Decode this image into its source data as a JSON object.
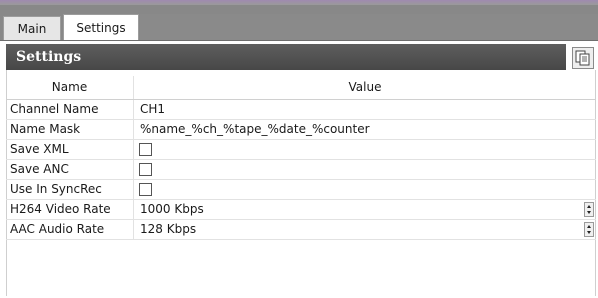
{
  "tabs": [
    {
      "label": "Main"
    },
    {
      "label": "Settings"
    }
  ],
  "panel": {
    "title": "Settings"
  },
  "grid": {
    "headers": {
      "name": "Name",
      "value": "Value"
    },
    "rows": [
      {
        "name": "Channel Name",
        "value": "CH1"
      },
      {
        "name": "Name Mask",
        "value": "%name_%ch_%tape_%date_%counter"
      },
      {
        "name": "Save XML",
        "checked": false
      },
      {
        "name": "Save ANC",
        "checked": false
      },
      {
        "name": "Use In SyncRec",
        "checked": false
      },
      {
        "name": "H264 Video Rate",
        "value": "1000 Kbps"
      },
      {
        "name": "AAC Audio Rate",
        "value": "128 Kbps"
      }
    ]
  },
  "icons": {
    "copy": "copy-icon",
    "spinner": "spinner-icon"
  },
  "colors": {
    "header_bg": "#4e4e4e",
    "tabbar_bg": "#888888"
  }
}
